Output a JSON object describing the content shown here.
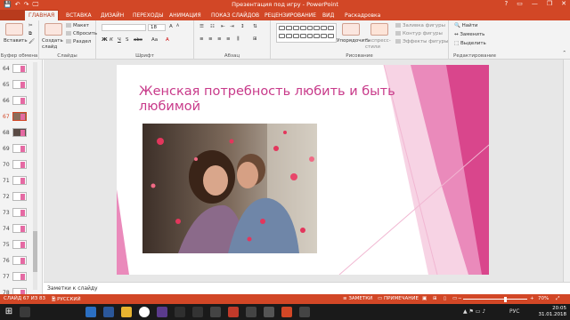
{
  "window": {
    "title": "Презентация под игру - PowerPoint",
    "controls": [
      "?",
      "▭",
      "—",
      "❐",
      "✕"
    ]
  },
  "quick_access": [
    "💾",
    "↶",
    "↷",
    "🖵"
  ],
  "tabs": [
    "ФАЙЛ",
    "ГЛАВНАЯ",
    "ВСТАВКА",
    "ДИЗАЙН",
    "ПЕРЕХОДЫ",
    "АНИМАЦИЯ",
    "ПОКАЗ СЛАЙДОВ",
    "РЕЦЕНЗИРОВАНИЕ",
    "ВИД",
    "Раскадровка"
  ],
  "ribbon": {
    "clipboard": {
      "label": "Буфер обмена",
      "paste": "Вставить"
    },
    "slides": {
      "label": "Слайды",
      "new_slide": "Создать слайд",
      "layout": "Макет",
      "reset": "Сбросить",
      "section": "Раздел"
    },
    "font": {
      "label": "Шрифт",
      "size": "18",
      "bold": "Ж",
      "italic": "К",
      "underline": "Ч",
      "strike": "S",
      "spacing": "abc",
      "case": "Аа",
      "grow": "A",
      "shrink": "A"
    },
    "paragraph": {
      "label": "Абзац"
    },
    "drawing": {
      "label": "Рисование",
      "arrange": "Упорядочить",
      "quick_styles": "Экспресс-стили",
      "fill": "Заливка фигуры",
      "outline": "Контур фигуры",
      "effects": "Эффекты фигуры"
    },
    "editing": {
      "label": "Редактирование",
      "find": "Найти",
      "replace": "Заменить",
      "select": "Выделить"
    }
  },
  "thumbnails": {
    "numbers": [
      "64",
      "65",
      "66",
      "67",
      "68",
      "69",
      "70",
      "71",
      "72",
      "73",
      "74",
      "75",
      "76",
      "77",
      "78"
    ],
    "selected": "67"
  },
  "slide": {
    "title": "Женская потребность любить и быть любимой"
  },
  "notes": {
    "placeholder": "Заметки к слайду"
  },
  "status": {
    "slide_info": "СЛАЙД 67 ИЗ 83",
    "language": "РУССКИЙ",
    "notes_btn": "ЗАМЕТКИ",
    "comments_btn": "ПРИМЕЧАНИЕ",
    "zoom_level": "70%"
  },
  "taskbar": {
    "time": "20:05",
    "date": "31.01.2018",
    "lang": "РУС"
  },
  "colors": {
    "accent": "#d24726",
    "title_pink": "#c83a8a",
    "slide_pink": "#e56aa3"
  }
}
